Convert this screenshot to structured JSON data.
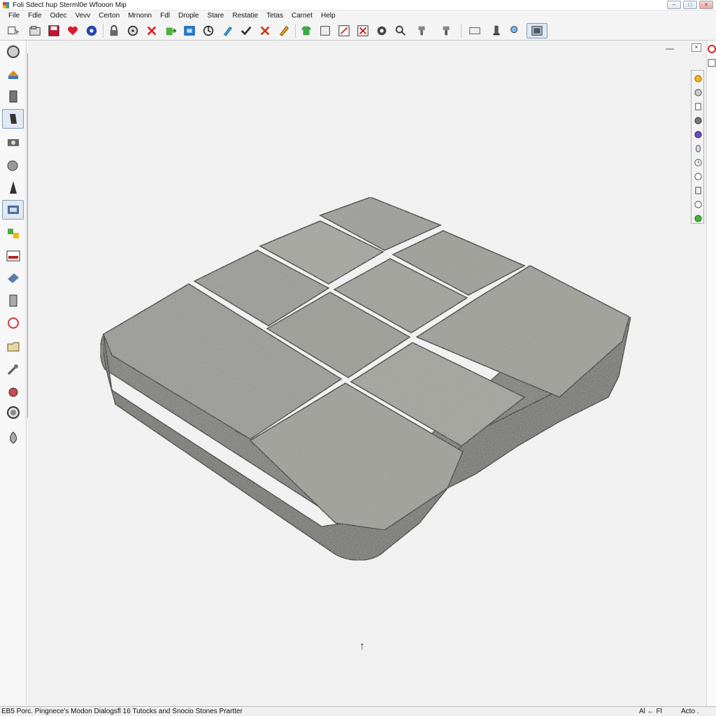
{
  "window": {
    "title": "Foli Sdect hup Sterml0e Wfooon Mip"
  },
  "window_controls": {
    "minimize": "–",
    "maximize": "□",
    "close": "×"
  },
  "menu": [
    {
      "label": "File"
    },
    {
      "label": "Fdle"
    },
    {
      "label": "Odec"
    },
    {
      "label": "Vevv"
    },
    {
      "label": "Certon"
    },
    {
      "label": "Mrnonn"
    },
    {
      "label": "Fdl"
    },
    {
      "label": "Drople"
    },
    {
      "label": "Stare"
    },
    {
      "label": "Restatie"
    },
    {
      "label": "Tetas"
    },
    {
      "label": "Carnet"
    },
    {
      "label": "Help"
    }
  ],
  "toolbar": {
    "icons": [
      "select-icon",
      "open-folder-icon",
      "save-icon",
      "heart-icon",
      "globe-icon",
      "lock-icon",
      "orbit-icon",
      "delete-icon",
      "push-pull-icon",
      "paint-bucket-icon",
      "rotate-icon",
      "tape-measure-icon",
      "checkmark-icon",
      "erase-icon",
      "pencil-icon",
      "shirt-icon",
      "rectangle-icon",
      "section-icon",
      "cancel-box-icon",
      "gear-icon",
      "search-icon",
      "move-icon",
      "text-icon",
      "dimension-icon",
      "layer-icon",
      "paint-icon",
      "camera-icon",
      "zoom-window-icon"
    ]
  },
  "viewport": {
    "axis_glyph": "↑",
    "minimize_glyph": "—"
  },
  "right_panel": {
    "close_glyph": "×"
  },
  "status": {
    "left_text": "EB5 Porc. Pingnece's Modon Dialogsfl 16 Tutocks and Snocio Stones Prartter",
    "mid_text": "Al ← Fl",
    "right_text": "Acto ."
  },
  "colors": {
    "canvas": "#f1f1f1",
    "stone_top": "#9c9c98",
    "stone_side": "#7d7d7a",
    "outline": "#2d2d2d"
  }
}
